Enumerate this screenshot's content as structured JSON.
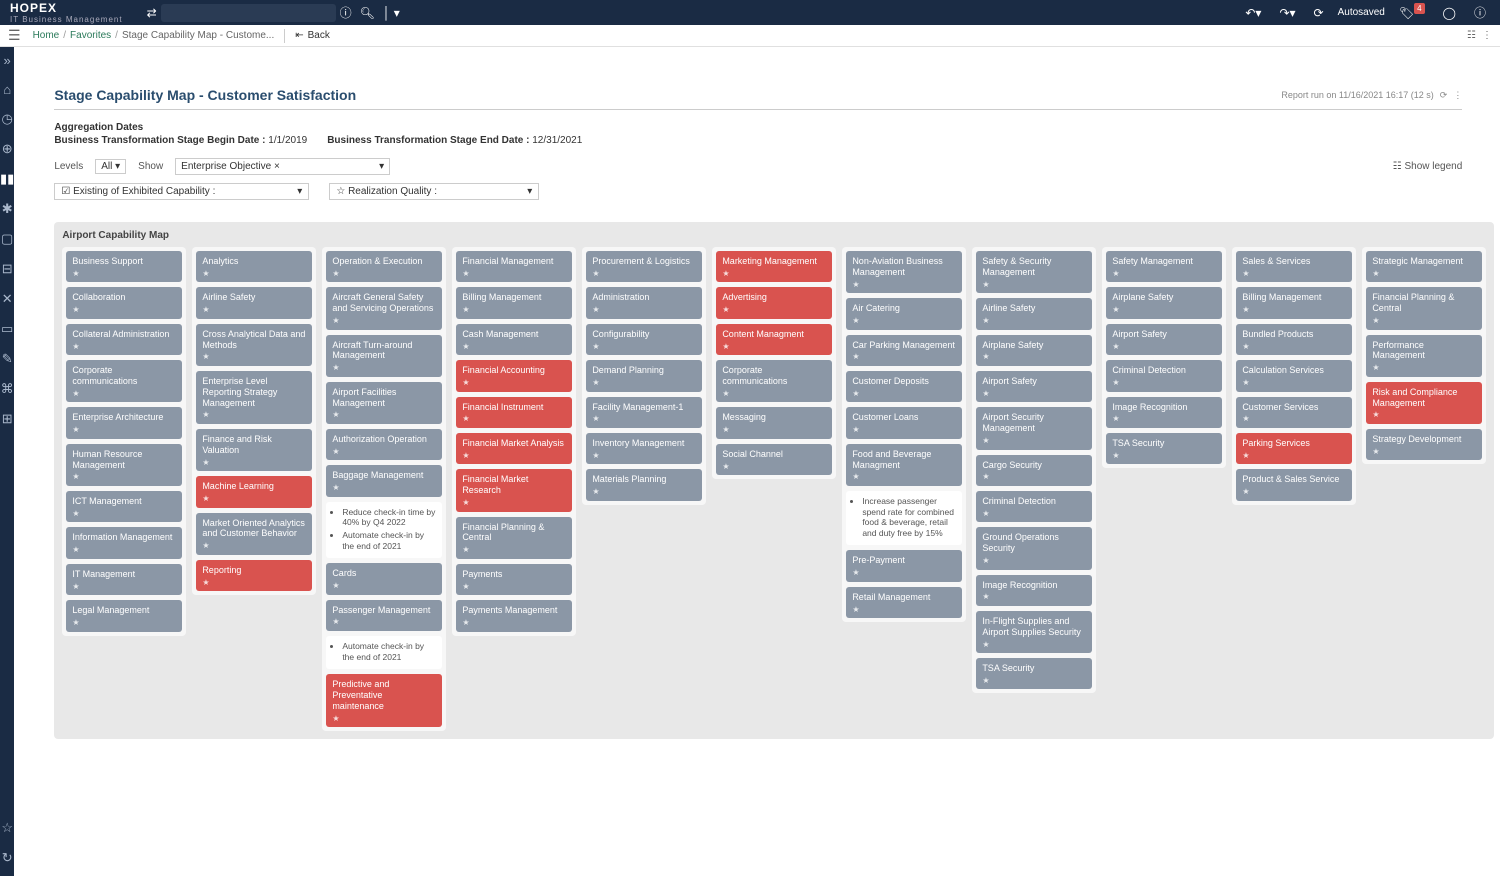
{
  "header": {
    "brand": "HOPEX",
    "brand_sub": "IT Business Management",
    "autosaved": "Autosaved",
    "notif_count": "4"
  },
  "breadcrumb": {
    "home": "Home",
    "favorites": "Favorites",
    "current": "Stage Capability Map - Custome...",
    "back": "Back"
  },
  "page": {
    "title": "Stage Capability Map - Customer Satisfaction",
    "run_info": "Report run on 11/16/2021 16:17 (12 s)",
    "agg_label": "Aggregation Dates",
    "begin_label": "Business Transformation Stage Begin Date :",
    "begin_value": "1/1/2019",
    "end_label": "Business Transformation Stage End Date :",
    "end_value": "12/31/2021"
  },
  "filters": {
    "levels_label": "Levels",
    "levels_value": "All",
    "show_label": "Show",
    "show_value": "Enterprise Objective ×",
    "existing_label": "Existing of Exhibited Capability :",
    "quality_label": "Realization Quality :",
    "legend": "Show legend"
  },
  "map": {
    "title": "Airport Capability Map",
    "columns": [
      {
        "header": {
          "label": "Business Support",
          "color": "gray"
        },
        "cards": [
          {
            "label": "Collaboration",
            "color": "gray"
          },
          {
            "label": "Collateral Administration",
            "color": "gray"
          },
          {
            "label": "Corporate communications",
            "color": "gray"
          },
          {
            "label": "Enterprise Architecture",
            "color": "gray"
          },
          {
            "label": "Human Resource Management",
            "color": "gray"
          },
          {
            "label": "ICT Management",
            "color": "gray"
          },
          {
            "label": "Information Management",
            "color": "gray"
          },
          {
            "label": "IT Management",
            "color": "gray"
          },
          {
            "label": "Legal Management",
            "color": "gray"
          }
        ]
      },
      {
        "header": {
          "label": "Analytics",
          "color": "gray"
        },
        "cards": [
          {
            "label": "Airline Safety",
            "color": "gray"
          },
          {
            "label": "Cross Analytical Data and Methods",
            "color": "gray"
          },
          {
            "label": "Enterprise Level Reporting Strategy Management",
            "color": "gray"
          },
          {
            "label": "Finance and Risk Valuation",
            "color": "gray"
          },
          {
            "label": "Machine Learning",
            "color": "red"
          },
          {
            "label": "Market Oriented Analytics and Customer Behavior",
            "color": "gray"
          },
          {
            "label": "Reporting",
            "color": "red"
          }
        ]
      },
      {
        "header": {
          "label": "Operation & Execution",
          "color": "gray"
        },
        "cards": [
          {
            "label": "Aircraft General Safety and Servicing Operations",
            "color": "gray"
          },
          {
            "label": "Aircraft Turn-around Management",
            "color": "gray"
          },
          {
            "label": "Airport Facilities Management",
            "color": "gray"
          },
          {
            "label": "Authorization Operation",
            "color": "gray"
          },
          {
            "label": "Baggage Management",
            "color": "gray"
          },
          {
            "label": "",
            "type": "note",
            "items": [
              "Reduce check-in time by 40% by Q4 2022",
              "Automate check-in by the end of 2021"
            ]
          },
          {
            "label": "Cards",
            "color": "gray"
          },
          {
            "label": "Passenger Management",
            "color": "gray"
          },
          {
            "label": "",
            "type": "note",
            "items": [
              "Automate check-in by the end of 2021"
            ]
          },
          {
            "label": "Predictive and Preventative maintenance",
            "color": "red"
          }
        ]
      },
      {
        "header": {
          "label": "Financial Management",
          "color": "gray"
        },
        "cards": [
          {
            "label": "Billing Management",
            "color": "gray"
          },
          {
            "label": "Cash Management",
            "color": "gray"
          },
          {
            "label": "Financial Accounting",
            "color": "red"
          },
          {
            "label": "Financial Instrument",
            "color": "red"
          },
          {
            "label": "Financial Market Analysis",
            "color": "red"
          },
          {
            "label": "Financial Market Research",
            "color": "red"
          },
          {
            "label": "Financial Planning & Central",
            "color": "gray"
          },
          {
            "label": "Payments",
            "color": "gray"
          },
          {
            "label": "Payments Management",
            "color": "gray"
          }
        ]
      },
      {
        "header": {
          "label": "Procurement & Logistics",
          "color": "gray"
        },
        "cards": [
          {
            "label": "Administration",
            "color": "gray"
          },
          {
            "label": "Configurability",
            "color": "gray"
          },
          {
            "label": "Demand Planning",
            "color": "gray"
          },
          {
            "label": "Facility Management-1",
            "color": "gray"
          },
          {
            "label": "Inventory Management",
            "color": "gray"
          },
          {
            "label": "Materials Planning",
            "color": "gray"
          }
        ]
      },
      {
        "header": {
          "label": "Marketing Management",
          "color": "red"
        },
        "cards": [
          {
            "label": "Advertising",
            "color": "red"
          },
          {
            "label": "Content Managment",
            "color": "red"
          },
          {
            "label": "Corporate communications",
            "color": "gray"
          },
          {
            "label": "Messaging",
            "color": "gray"
          },
          {
            "label": "Social Channel",
            "color": "gray"
          }
        ]
      },
      {
        "header": {
          "label": "Non-Aviation Business Management",
          "color": "gray"
        },
        "cards": [
          {
            "label": "Air Catering",
            "color": "gray"
          },
          {
            "label": "Car Parking Management",
            "color": "gray"
          },
          {
            "label": "Customer Deposits",
            "color": "gray"
          },
          {
            "label": "Customer Loans",
            "color": "gray"
          },
          {
            "label": "Food and Beverage Managment",
            "color": "gray"
          },
          {
            "label": "",
            "type": "note",
            "items": [
              "Increase passenger spend rate for combined food & beverage, retail and duty free by 15%"
            ]
          },
          {
            "label": "Pre-Payment",
            "color": "gray"
          },
          {
            "label": "Retail Management",
            "color": "gray"
          }
        ]
      },
      {
        "header": {
          "label": "Safety & Security Management",
          "color": "gray"
        },
        "cards": [
          {
            "label": "Airline Safety",
            "color": "gray"
          },
          {
            "label": "Airplane Safety",
            "color": "gray"
          },
          {
            "label": "Airport Safety",
            "color": "gray"
          },
          {
            "label": "Airport Security Management",
            "color": "gray"
          },
          {
            "label": "Cargo Security",
            "color": "gray"
          },
          {
            "label": "Criminal Detection",
            "color": "gray"
          },
          {
            "label": "Ground Operations Security",
            "color": "gray"
          },
          {
            "label": "Image Recognition",
            "color": "gray"
          },
          {
            "label": "In-Flight Supplies and Airport Supplies Security",
            "color": "gray"
          },
          {
            "label": "TSA Security",
            "color": "gray"
          }
        ]
      },
      {
        "header": {
          "label": "Safety Management",
          "color": "gray"
        },
        "cards": [
          {
            "label": "Airplane Safety",
            "color": "gray"
          },
          {
            "label": "Airport Safety",
            "color": "gray"
          },
          {
            "label": "Criminal Detection",
            "color": "gray"
          },
          {
            "label": "Image Recognition",
            "color": "gray"
          },
          {
            "label": "TSA Security",
            "color": "gray"
          }
        ]
      },
      {
        "header": {
          "label": "Sales & Services",
          "color": "gray"
        },
        "cards": [
          {
            "label": "Billing Management",
            "color": "gray"
          },
          {
            "label": "Bundled Products",
            "color": "gray"
          },
          {
            "label": "Calculation Services",
            "color": "gray"
          },
          {
            "label": "Customer Services",
            "color": "gray"
          },
          {
            "label": "Parking Services",
            "color": "red"
          },
          {
            "label": "Product & Sales Service",
            "color": "gray"
          }
        ]
      },
      {
        "header": {
          "label": "Strategic Management",
          "color": "gray"
        },
        "cards": [
          {
            "label": "Financial Planning & Central",
            "color": "gray"
          },
          {
            "label": "Performance Management",
            "color": "gray"
          },
          {
            "label": "Risk and Compliance Management",
            "color": "red"
          },
          {
            "label": "Strategy Development",
            "color": "gray"
          }
        ]
      }
    ]
  }
}
